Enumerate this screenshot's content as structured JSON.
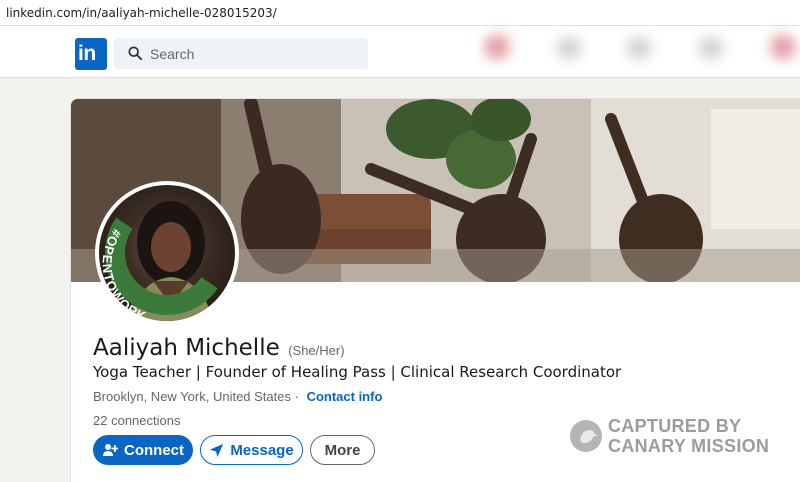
{
  "browser": {
    "url": "linkedin.com/in/aaliyah-michelle-028015203/"
  },
  "navbar": {
    "logo_text": "in",
    "search_placeholder": "Search"
  },
  "profile": {
    "badge_text": "#OPENTOWORK",
    "name": "Aaliyah Michelle",
    "pronouns": "(She/Her)",
    "headline": "Yoga Teacher | Founder of Healing Pass | Clinical Research Coordinator",
    "location": "Brooklyn, New York, United States",
    "location_separator": " · ",
    "contact_info": "Contact info",
    "connections_count": "22",
    "connections_label": "connections",
    "actions": {
      "connect": "Connect",
      "message": "Message",
      "more": "More"
    }
  },
  "watermark": {
    "line1": "CAPTURED BY",
    "line2": "CANARY MISSION"
  },
  "colors": {
    "brand_blue": "#0a66c2",
    "open_to_work_green": "#3b7a3a"
  }
}
